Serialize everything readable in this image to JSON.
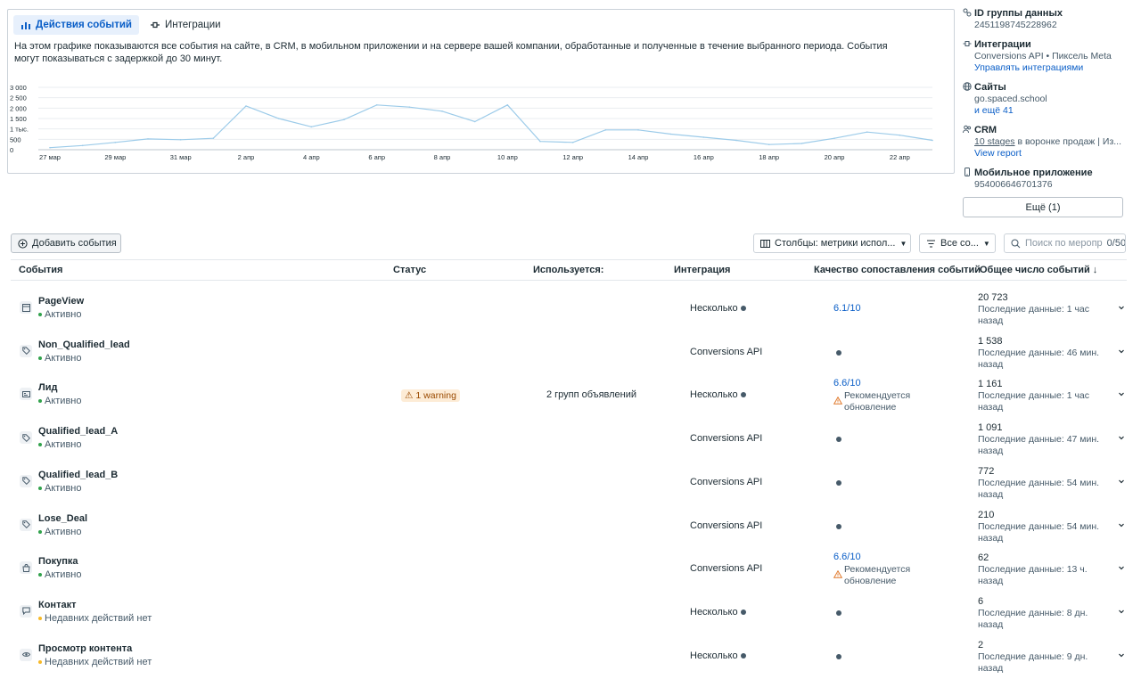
{
  "tabs": [
    {
      "label": "Действия событий",
      "active": true
    },
    {
      "label": "Интеграции",
      "active": false
    }
  ],
  "chart": {
    "description": "На этом графике показываются все события на сайте, в CRM, в мобильном приложении и на сервере вашей компании, обработанные и полученные в течение выбранного периода. События могут показываться с задержкой до 30 минут.",
    "line_color": "#9ccbe9",
    "y_ticks": [
      "3 000",
      "2 500",
      "2 000",
      "1 500",
      "1 тыс.",
      "500",
      "0"
    ],
    "x_ticks": [
      "27 мар",
      "29 мар",
      "31 мар",
      "2 апр",
      "4 апр",
      "6 апр",
      "8 апр",
      "10 апр",
      "12 апр",
      "14 апр",
      "16 апр",
      "18 апр",
      "20 апр",
      "22 апр"
    ]
  },
  "chart_data": {
    "type": "line",
    "title": "",
    "xlabel": "",
    "ylabel": "",
    "ylim": [
      0,
      3000
    ],
    "grid": true,
    "categories": [
      "27 мар",
      "28 мар",
      "29 мар",
      "30 мар",
      "31 мар",
      "1 апр",
      "2 апр",
      "3 апр",
      "4 апр",
      "5 апр",
      "6 апр",
      "7 апр",
      "8 апр",
      "9 апр",
      "10 апр",
      "11 апр",
      "12 апр",
      "13 апр",
      "14 апр",
      "15 апр",
      "16 апр",
      "17 апр",
      "18 апр",
      "19 апр",
      "20 апр",
      "21 апр",
      "22 апр",
      "23 апр"
    ],
    "series": [
      {
        "values": [
          100,
          200,
          350,
          520,
          480,
          550,
          2100,
          1500,
          1100,
          1450,
          2150,
          2050,
          1850,
          1350,
          2150,
          400,
          350,
          950,
          950,
          750,
          600,
          450,
          250,
          300,
          550,
          850,
          700,
          450
        ]
      }
    ]
  },
  "side": {
    "dataset_title": "ID группы данных",
    "dataset_id": "2451198745228962",
    "integrations_title": "Интеграции",
    "integrations_text": "Conversions API • Пиксель Meta",
    "integrations_link": "Управлять интеграциями",
    "sites_title": "Сайты",
    "sites_text": "go.spaced.school",
    "sites_link": "и ещё 41",
    "crm_title": "CRM",
    "crm_stages": "10 stages",
    "crm_text": " в воронке продаж | Из...",
    "crm_link": "View report",
    "mobile_title": "Мобильное приложение",
    "mobile_id": "954006646701376",
    "more_button": "Ещё (1)"
  },
  "toolbar": {
    "add_events": "Добавить события",
    "columns": "Столбцы: метрики испол...",
    "filter": "Все со...",
    "search_placeholder": "Поиск по меропр",
    "search_count": "0/50"
  },
  "table": {
    "headers": {
      "events": "События",
      "status": "Статус",
      "used": "Используется:",
      "integration": "Интеграция",
      "quality": "Качество сопоставления событий",
      "total": "Общее число событий ↓"
    },
    "rows": [
      {
        "name": "PageView",
        "status": "Активно",
        "status_color": "green",
        "icon": "browser-icon",
        "warning": "",
        "used": "",
        "integration": "Несколько",
        "integration_info": true,
        "quality": "6.1/10",
        "recommend": "",
        "total": "20 723",
        "last": "Последние данные: 1 час назад"
      },
      {
        "name": "Non_Qualified_lead",
        "status": "Активно",
        "status_color": "green",
        "icon": "tag-icon",
        "warning": "",
        "used": "",
        "integration": "Conversions API",
        "integration_info": false,
        "quality": "",
        "recommend": "",
        "total": "1 538",
        "last": "Последние данные: 46 мин. назад"
      },
      {
        "name": "Лид",
        "status": "Активно",
        "status_color": "green",
        "icon": "id-card-icon",
        "warning": "1 warning",
        "used": "2 групп объявлений",
        "integration": "Несколько",
        "integration_info": true,
        "quality": "6.6/10",
        "recommend": "Рекомендуется обновление",
        "total": "1 161",
        "last": "Последние данные: 1 час назад"
      },
      {
        "name": "Qualified_lead_A",
        "status": "Активно",
        "status_color": "green",
        "icon": "tag-icon",
        "warning": "",
        "used": "",
        "integration": "Conversions API",
        "integration_info": false,
        "quality": "",
        "recommend": "",
        "total": "1 091",
        "last": "Последние данные: 47 мин. назад"
      },
      {
        "name": "Qualified_lead_B",
        "status": "Активно",
        "status_color": "green",
        "icon": "tag-icon",
        "warning": "",
        "used": "",
        "integration": "Conversions API",
        "integration_info": false,
        "quality": "",
        "recommend": "",
        "total": "772",
        "last": "Последние данные: 54 мин. назад"
      },
      {
        "name": "Lose_Deal",
        "status": "Активно",
        "status_color": "green",
        "icon": "tag-icon",
        "warning": "",
        "used": "",
        "integration": "Conversions API",
        "integration_info": false,
        "quality": "",
        "recommend": "",
        "total": "210",
        "last": "Последние данные: 54 мин. назад"
      },
      {
        "name": "Покупка",
        "status": "Активно",
        "status_color": "green",
        "icon": "shopping-bag-icon",
        "warning": "",
        "used": "",
        "integration": "Conversions API",
        "integration_info": false,
        "quality": "6.6/10",
        "recommend": "Рекомендуется обновление",
        "total": "62",
        "last": "Последние данные: 13 ч. назад"
      },
      {
        "name": "Контакт",
        "status": "Недавних действий нет",
        "status_color": "yellow",
        "icon": "chat-icon",
        "warning": "",
        "used": "",
        "integration": "Несколько",
        "integration_info": true,
        "quality": "",
        "recommend": "",
        "total": "6",
        "last": "Последние данные: 8 дн. назад"
      },
      {
        "name": "Просмотр контента",
        "status": "Недавних действий нет",
        "status_color": "yellow",
        "icon": "eye-icon",
        "warning": "",
        "used": "",
        "integration": "Несколько",
        "integration_info": true,
        "quality": "",
        "recommend": "",
        "total": "2",
        "last": "Последние данные: 9 дн. назад"
      }
    ]
  }
}
